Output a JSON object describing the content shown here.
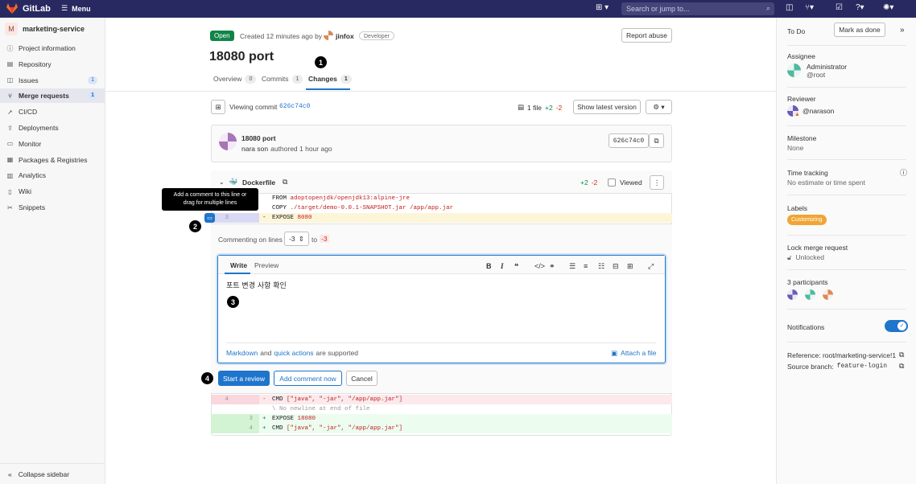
{
  "topbar": {
    "logo": "GitLab",
    "menu": "Menu",
    "search_placeholder": "Search or jump to..."
  },
  "sidebar": {
    "project": {
      "initial": "M",
      "name": "marketing-service"
    },
    "items": [
      {
        "label": "Project information",
        "icon": "info-icon"
      },
      {
        "label": "Repository",
        "icon": "repository-icon"
      },
      {
        "label": "Issues",
        "icon": "issues-icon",
        "badge": "1"
      },
      {
        "label": "Merge requests",
        "icon": "merge-request-icon",
        "badge": "1",
        "active": true
      },
      {
        "label": "CI/CD",
        "icon": "rocket-icon"
      },
      {
        "label": "Deployments",
        "icon": "deployments-icon"
      },
      {
        "label": "Monitor",
        "icon": "monitor-icon"
      },
      {
        "label": "Packages & Registries",
        "icon": "package-icon"
      },
      {
        "label": "Analytics",
        "icon": "chart-icon"
      },
      {
        "label": "Wiki",
        "icon": "book-icon"
      },
      {
        "label": "Snippets",
        "icon": "snippet-icon"
      }
    ],
    "collapse": "Collapse sidebar"
  },
  "mr": {
    "status": "Open",
    "created": "Created 12 minutes ago by",
    "author": "jinfox",
    "role": "Developer",
    "report": "Report abuse",
    "title": "18080 port",
    "tabs": [
      {
        "label": "Overview",
        "count": "0"
      },
      {
        "label": "Commits",
        "count": "1"
      },
      {
        "label": "Changes",
        "count": "1"
      }
    ]
  },
  "commitbar": {
    "viewing": "Viewing commit",
    "sha": "626c74c0",
    "files": "1 file",
    "plus": "+2",
    "minus": "-2",
    "latest": "Show latest version"
  },
  "commit": {
    "title": "18080 port",
    "author": "nara son",
    "authored": "authored 1 hour ago",
    "sha": "626c74c0"
  },
  "file": {
    "name": "Dockerfile",
    "plus": "+2",
    "minus": "-2",
    "viewed": "Viewed"
  },
  "tooltip": {
    "line1": "Add a comment to this line or",
    "line2": "drag for multiple lines"
  },
  "code_top": [
    {
      "sign": "",
      "kw": "FROM",
      "rest": "adoptopenjdk/openjdk13:alpine-jre"
    },
    {
      "sign": "",
      "kw": "COPY",
      "rest": "./target/demo-0.0.1-SNAPSHOT.jar /app/app.jar"
    },
    {
      "old": "3",
      "sign": "-",
      "kw": "EXPOSE",
      "rest": "8080"
    }
  ],
  "comment": {
    "lines_label": "Commenting on lines",
    "from": "-3",
    "to_label": "to",
    "to": "-3",
    "tab_write": "Write",
    "tab_preview": "Preview",
    "text": "포트 변경 사항 확인",
    "markdown": "Markdown",
    "and": "and",
    "quick": "quick actions",
    "supported": "are supported",
    "attach": "Attach a file",
    "start_review": "Start a review",
    "add_now": "Add comment now",
    "cancel": "Cancel"
  },
  "code_bottom": [
    {
      "old": "4",
      "new": "",
      "sign": "-",
      "kw": "CMD",
      "rest": "[\"java\", \"-jar\", \"/app/app.jar\"]",
      "type": "del"
    },
    {
      "old": "",
      "new": "",
      "sign": "",
      "kw": "",
      "rest": "\\ No newline at end of file",
      "type": "meta"
    },
    {
      "old": "",
      "new": "3",
      "sign": "+",
      "kw": "EXPOSE",
      "rest": "18080",
      "type": "add"
    },
    {
      "old": "",
      "new": "4",
      "sign": "+",
      "kw": "CMD",
      "rest": "[\"java\", \"-jar\", \"/app/app.jar\"]",
      "type": "add"
    }
  ],
  "right": {
    "todo": "To Do",
    "mark_done": "Mark as done",
    "assignee_h": "Assignee",
    "assignee_name": "Administrator",
    "assignee_user": "@root",
    "reviewer_h": "Reviewer",
    "reviewer_user": "@narason",
    "milestone_h": "Milestone",
    "milestone_v": "None",
    "time_h": "Time tracking",
    "time_v": "No estimate or time spent",
    "labels_h": "Labels",
    "label": "Customizing",
    "lock_h": "Lock merge request",
    "lock_v": "Unlocked",
    "participants": "3 participants",
    "notifications": "Notifications",
    "reference": "Reference: root/marketing-service!1",
    "branch_label": "Source branch:",
    "branch": "feature-login"
  },
  "callouts": [
    "1",
    "2",
    "3",
    "4"
  ],
  "colors": {
    "topbar": "#292961",
    "primary": "#1f75cb",
    "open": "#108548",
    "label": "#f0a535",
    "del_bg": "#fbe9eb",
    "add_bg": "#ecfdf0"
  }
}
